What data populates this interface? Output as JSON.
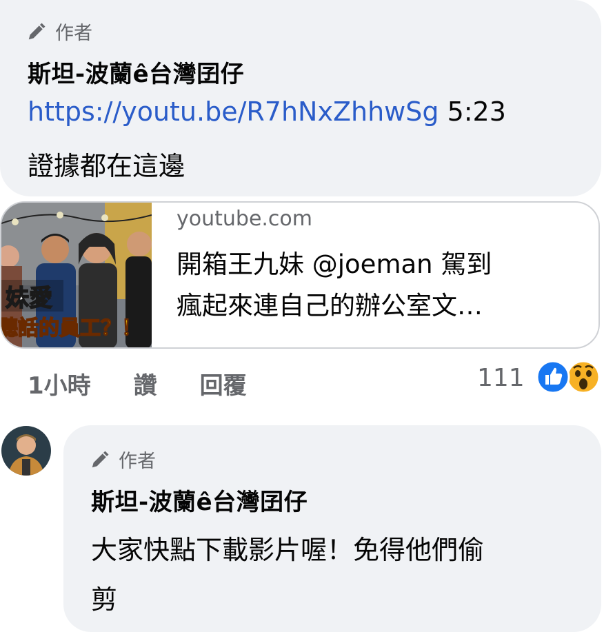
{
  "comment1": {
    "author_tag": "作者",
    "author_name": "斯坦-波蘭ê台灣囝仔",
    "link": "https://youtu.be/R7hNxZhhwSg",
    "timestamp_ref": " 5:23",
    "text": "證據都在這邊"
  },
  "link_card": {
    "domain": "youtube.com",
    "title_line1": "開箱王九妹 @joeman 駕到",
    "title_line2": "瘋起來連自己的辦公室文…",
    "thumb_text1": "妹愛",
    "thumb_text2": "聽話的員工？！"
  },
  "actions": {
    "time": "1小時",
    "like": "讚",
    "reply": "回覆"
  },
  "reactions": {
    "count": "111",
    "icons": [
      "like-icon",
      "wow-icon"
    ],
    "colors": {
      "like": "#1877f2",
      "wow": "#f7b125"
    }
  },
  "comment2": {
    "author_tag": "作者",
    "author_name": "斯坦-波蘭ê台灣囝仔",
    "text_line1": "大家快點下載影片喔！免得他們偷",
    "text_line2": "剪"
  }
}
